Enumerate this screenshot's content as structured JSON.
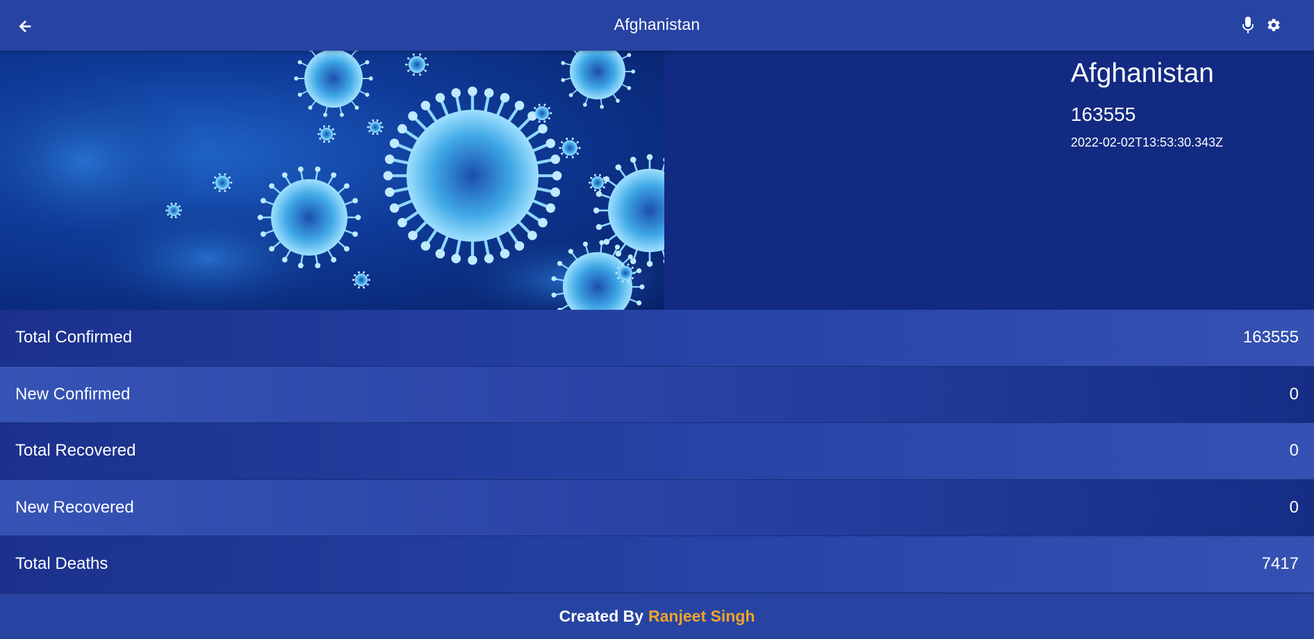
{
  "header": {
    "title": "Afghanistan",
    "back_icon": "arrow-left-icon",
    "mic_icon": "microphone-icon",
    "settings_icon": "gear-icon"
  },
  "hero": {
    "image": "coronavirus-illustration",
    "country": "Afghanistan",
    "total": "163555",
    "updated": "2022-02-02T13:53:30.343Z"
  },
  "stats": [
    {
      "label": "Total Confirmed",
      "value": "163555"
    },
    {
      "label": "New Confirmed",
      "value": "0"
    },
    {
      "label": "Total Recovered",
      "value": "0"
    },
    {
      "label": "New Recovered",
      "value": "0"
    },
    {
      "label": "Total Deaths",
      "value": "7417"
    }
  ],
  "footer": {
    "prefix": "Created By",
    "author": "Ranjeet Singh"
  },
  "colors": {
    "header": "#2744a3",
    "hero_background": "#122a82",
    "author_accent": "#f4a42a",
    "text": "#ffffff"
  }
}
